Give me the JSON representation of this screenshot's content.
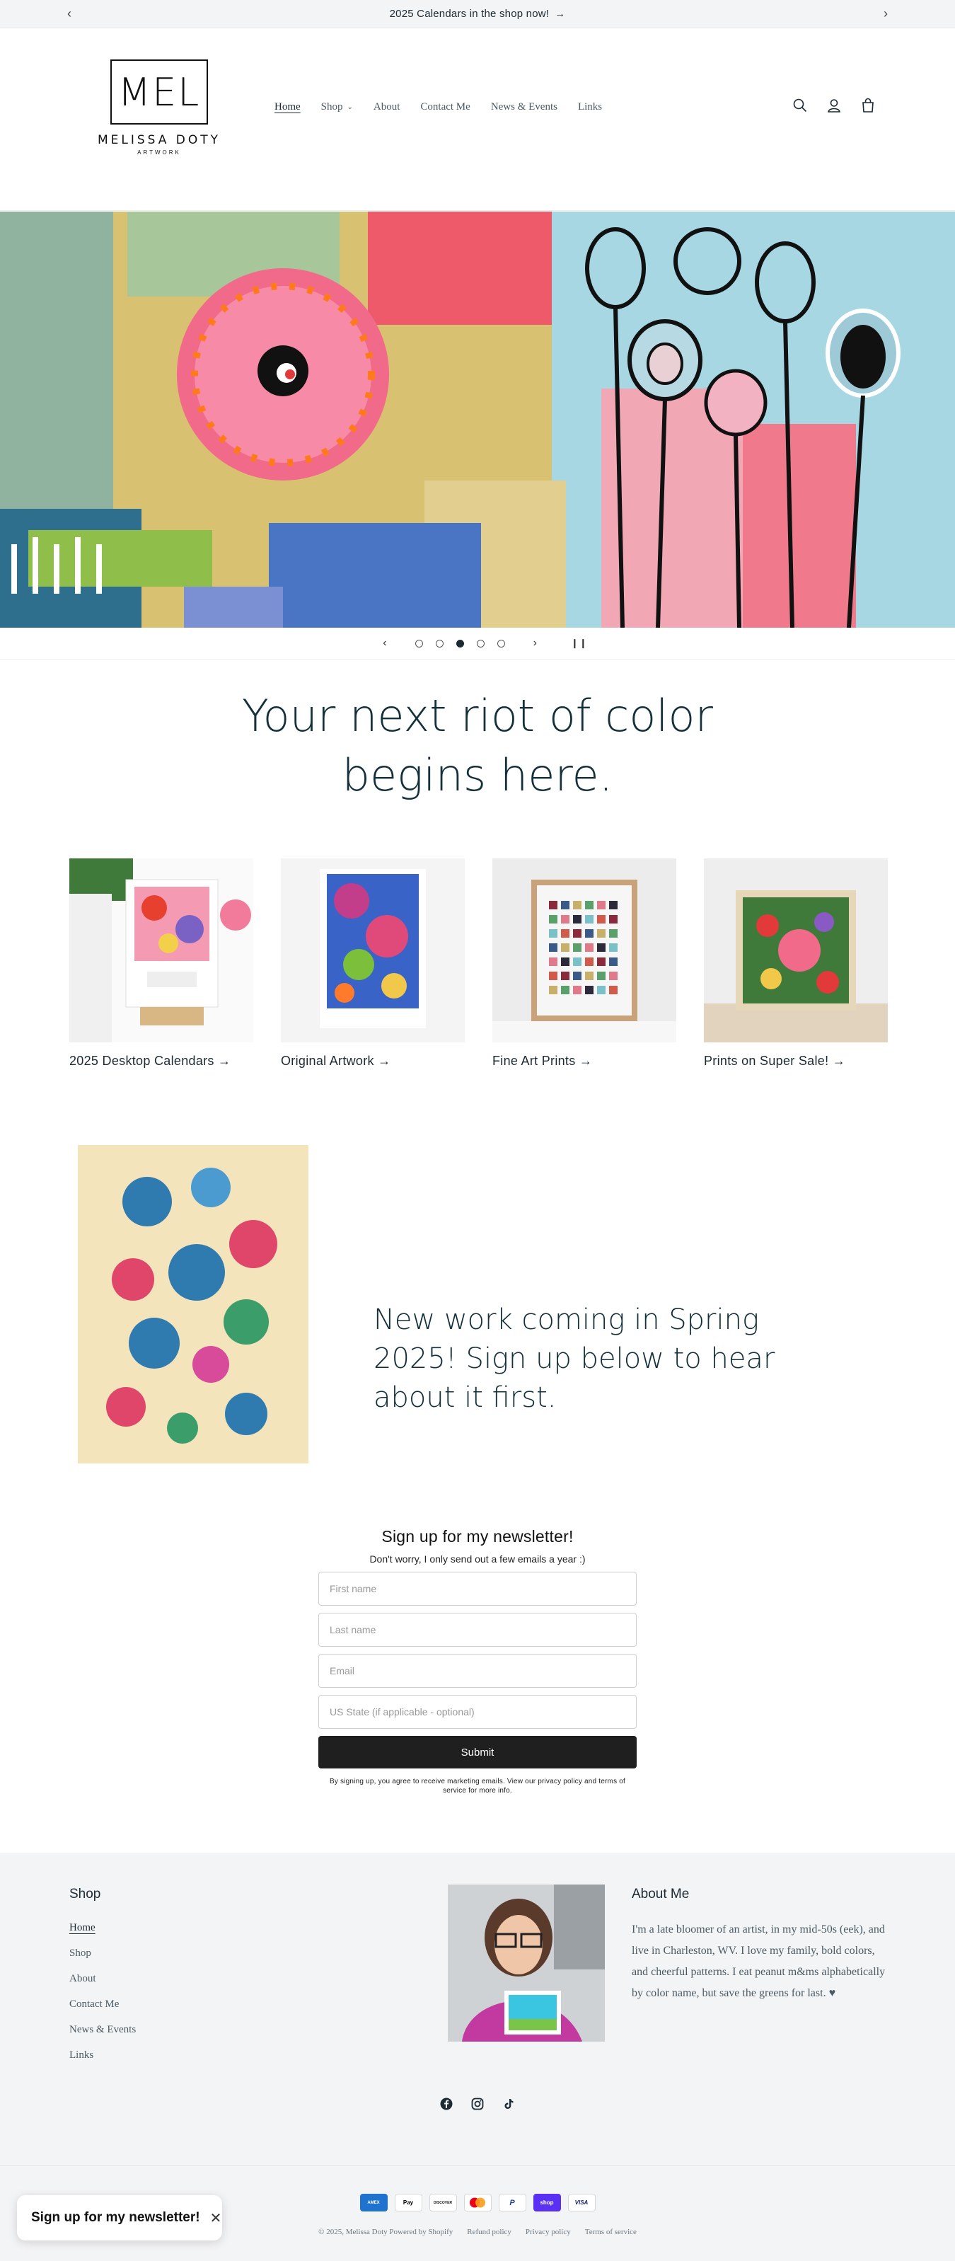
{
  "announcement": {
    "text": "2025 Calendars in the shop now!",
    "arrow": "→"
  },
  "logo": {
    "mark": "MEL",
    "name": "MELISSA DOTY",
    "sub": "ARTWORK"
  },
  "nav": [
    {
      "label": "Home",
      "active": true
    },
    {
      "label": "Shop",
      "dropdown": true
    },
    {
      "label": "About"
    },
    {
      "label": "Contact Me"
    },
    {
      "label": "News & Events"
    },
    {
      "label": "Links"
    }
  ],
  "slider": {
    "slides": 5,
    "current": 3
  },
  "headline": {
    "line1": "Your next riot of color",
    "line2": "begins here."
  },
  "collections": [
    {
      "label": "2025 Desktop Calendars →"
    },
    {
      "label": "Original Artwork →"
    },
    {
      "label": "Fine Art Prints →"
    },
    {
      "label": "Prints on Super Sale! →"
    }
  ],
  "featured": {
    "text": "New work coming in Spring 2025! Sign up below to hear about it first."
  },
  "newsletter": {
    "title": "Sign up for my newsletter!",
    "subtitle": "Don't worry, I only send out a few emails a year :)",
    "fields": [
      "First name",
      "Last name",
      "Email",
      "US State (if applicable - optional)"
    ],
    "submit": "Submit",
    "legal": "By signing up, you agree to receive marketing emails. View our privacy policy and terms of service for more info."
  },
  "footer": {
    "shop_heading": "Shop",
    "links": [
      "Home",
      "Shop",
      "About",
      "Contact Me",
      "News & Events",
      "Links"
    ],
    "about_heading": "About Me",
    "about_text": "I'm a late bloomer of an artist, in my mid-50s (eek), and live in Charleston, WV. I love my family, bold colors, and cheerful patterns. I eat peanut m&ms alphabetically by color name, but save the greens for last. ♥",
    "payments": [
      "AMEX",
      "Pay",
      "DISCOVER",
      "MC",
      "P",
      "shop",
      "VISA"
    ],
    "copyright": "© 2025, Melissa Doty Powered by Shopify",
    "policies": [
      "Refund policy",
      "Privacy policy",
      "Terms of service"
    ]
  },
  "popup": {
    "text": "Sign up for my newsletter!",
    "close": "✕"
  }
}
